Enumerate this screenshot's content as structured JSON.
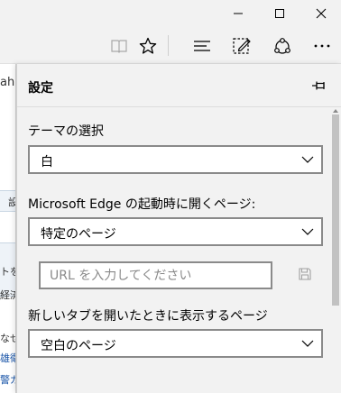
{
  "window": {
    "minimize_icon": "minimize-icon",
    "maximize_icon": "maximize-icon",
    "close_icon": "close-icon"
  },
  "toolbar": {
    "icons": [
      "reading-view-icon",
      "favorites-star-icon",
      "hub-icon",
      "web-note-icon",
      "share-icon",
      "more-icon"
    ]
  },
  "page_strip": {
    "lines": [
      "ahc",
      "設",
      "トを",
      "経済",
      "なせ",
      "雄衛",
      "警ガ"
    ]
  },
  "settings": {
    "title": "設定",
    "pin_icon": "pin-icon",
    "theme": {
      "label": "テーマの選択",
      "value": "白"
    },
    "startup": {
      "label": "Microsoft Edge の起動時に開くページ:",
      "value": "特定のページ"
    },
    "url": {
      "placeholder": "URL を入力してください",
      "value": ""
    },
    "new_tab": {
      "label": "新しいタブを開いたときに表示するページ",
      "value": "空白のページ"
    }
  },
  "colors": {
    "panel_bg": "#f2f2f2",
    "field_border": "#8a8a8a",
    "scroll_thumb": "#c2c2c2"
  }
}
